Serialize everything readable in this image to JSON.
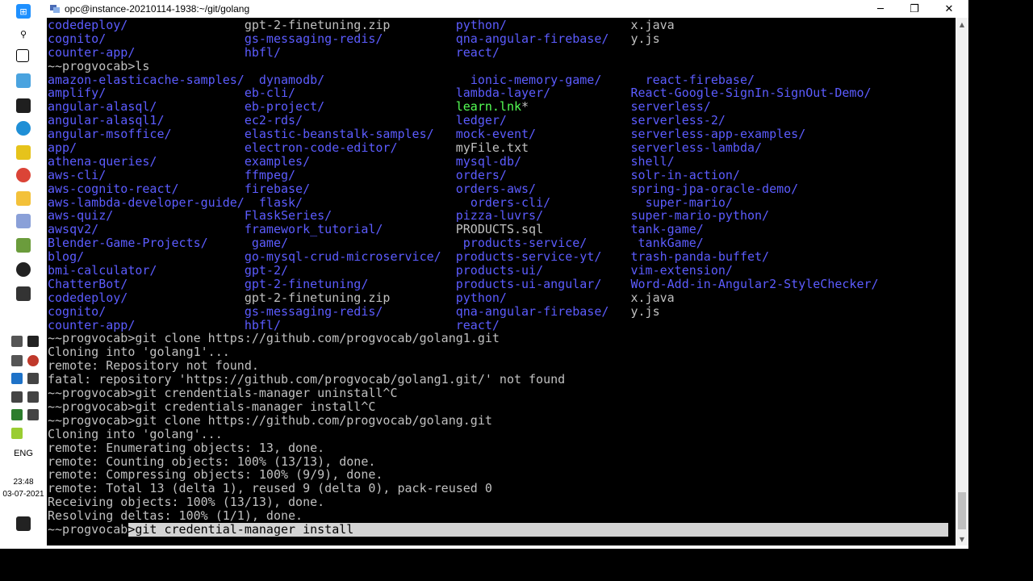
{
  "window": {
    "title": "opc@instance-20210114-1938:~/git/golang",
    "minimize_label": "─",
    "maximize_label": "❐",
    "close_label": "✕"
  },
  "taskbar": {
    "icons": [
      "windows-start-icon",
      "search-icon",
      "task-view-icon",
      "remote-desktop-icon",
      "store-icon",
      "edge-icon",
      "sticky-notes-icon",
      "chrome-icon",
      "file-explorer-icon",
      "putty-icon",
      "notepad-icon",
      "obs-icon",
      "terminal-icon"
    ],
    "language": "ENG",
    "time": "23:48",
    "date": "03-07-2021"
  },
  "terminal": {
    "lines": [
      [
        [
          "codedeploy/",
          "dir"
        ],
        [
          "                ",
          ""
        ],
        [
          "gpt-2-finetuning.zip",
          ""
        ],
        [
          "         ",
          ""
        ],
        [
          "python/",
          "dir"
        ],
        [
          "                 ",
          ""
        ],
        [
          "x.java",
          ""
        ]
      ],
      [
        [
          "cognito/",
          "dir"
        ],
        [
          "                   ",
          ""
        ],
        [
          "gs-messaging-redis/",
          "dir"
        ],
        [
          "          ",
          ""
        ],
        [
          "qna-angular-firebase/",
          "dir"
        ],
        [
          "   ",
          ""
        ],
        [
          "y.js",
          ""
        ]
      ],
      [
        [
          "counter-app/",
          "dir"
        ],
        [
          "               ",
          ""
        ],
        [
          "hbfl/",
          "dir"
        ],
        [
          "                        ",
          ""
        ],
        [
          "react/",
          "dir"
        ]
      ],
      [
        [
          "~~progvocab>ls",
          ""
        ]
      ],
      [
        [
          "amazon-elasticache-samples/",
          "dir"
        ],
        [
          "  ",
          ""
        ],
        [
          "dynamodb/",
          "dir"
        ],
        [
          "                    ",
          ""
        ],
        [
          "ionic-memory-game/",
          "dir"
        ],
        [
          "      ",
          ""
        ],
        [
          "react-firebase/",
          "dir"
        ]
      ],
      [
        [
          "amplify/",
          "dir"
        ],
        [
          "                   ",
          ""
        ],
        [
          "eb-cli/",
          "dir"
        ],
        [
          "                      ",
          ""
        ],
        [
          "lambda-layer/",
          "dir"
        ],
        [
          "           ",
          ""
        ],
        [
          "React-Google-SignIn-SignOut-Demo/",
          "dir"
        ]
      ],
      [
        [
          "angular-alasql/",
          "dir"
        ],
        [
          "            ",
          ""
        ],
        [
          "eb-project/",
          "dir"
        ],
        [
          "                  ",
          ""
        ],
        [
          "learn.lnk",
          "link"
        ],
        [
          "*",
          ""
        ],
        [
          "              ",
          ""
        ],
        [
          "serverless/",
          "dir"
        ]
      ],
      [
        [
          "angular-alasql1/",
          "dir"
        ],
        [
          "           ",
          ""
        ],
        [
          "ec2-rds/",
          "dir"
        ],
        [
          "                     ",
          ""
        ],
        [
          "ledger/",
          "dir"
        ],
        [
          "                 ",
          ""
        ],
        [
          "serverless-2/",
          "dir"
        ]
      ],
      [
        [
          "angular-msoffice/",
          "dir"
        ],
        [
          "          ",
          ""
        ],
        [
          "elastic-beanstalk-samples/",
          "dir"
        ],
        [
          "   ",
          ""
        ],
        [
          "mock-event/",
          "dir"
        ],
        [
          "             ",
          ""
        ],
        [
          "serverless-app-examples/",
          "dir"
        ]
      ],
      [
        [
          "app/",
          "dir"
        ],
        [
          "                       ",
          ""
        ],
        [
          "electron-code-editor/",
          "dir"
        ],
        [
          "        ",
          ""
        ],
        [
          "myFile.txt",
          ""
        ],
        [
          "              ",
          ""
        ],
        [
          "serverless-lambda/",
          "dir"
        ]
      ],
      [
        [
          "athena-queries/",
          "dir"
        ],
        [
          "            ",
          ""
        ],
        [
          "examples/",
          "dir"
        ],
        [
          "                    ",
          ""
        ],
        [
          "mysql-db/",
          "dir"
        ],
        [
          "               ",
          ""
        ],
        [
          "shell/",
          "dir"
        ]
      ],
      [
        [
          "aws-cli/",
          "dir"
        ],
        [
          "                   ",
          ""
        ],
        [
          "ffmpeg/",
          "dir"
        ],
        [
          "                      ",
          ""
        ],
        [
          "orders/",
          "dir"
        ],
        [
          "                 ",
          ""
        ],
        [
          "solr-in-action/",
          "dir"
        ]
      ],
      [
        [
          "aws-cognito-react/",
          "dir"
        ],
        [
          "         ",
          ""
        ],
        [
          "firebase/",
          "dir"
        ],
        [
          "                    ",
          ""
        ],
        [
          "orders-aws/",
          "dir"
        ],
        [
          "             ",
          ""
        ],
        [
          "spring-jpa-oracle-demo/",
          "dir"
        ]
      ],
      [
        [
          "aws-lambda-developer-guide/",
          "dir"
        ],
        [
          "  ",
          ""
        ],
        [
          "flask/",
          "dir"
        ],
        [
          "                       ",
          ""
        ],
        [
          "orders-cli/",
          "dir"
        ],
        [
          "             ",
          ""
        ],
        [
          "super-mario/",
          "dir"
        ]
      ],
      [
        [
          "aws-quiz/",
          "dir"
        ],
        [
          "                  ",
          ""
        ],
        [
          "FlaskSeries/",
          "dir"
        ],
        [
          "                 ",
          ""
        ],
        [
          "pizza-luvrs/",
          "dir"
        ],
        [
          "            ",
          ""
        ],
        [
          "super-mario-python/",
          "dir"
        ]
      ],
      [
        [
          "awsqv2/",
          "dir"
        ],
        [
          "                    ",
          ""
        ],
        [
          "framework_tutorial/",
          "dir"
        ],
        [
          "          ",
          ""
        ],
        [
          "PRODUCTS.sql",
          ""
        ],
        [
          "            ",
          ""
        ],
        [
          "tank-game/",
          "dir"
        ]
      ],
      [
        [
          "Blender-Game-Projects/",
          "dir"
        ],
        [
          "      ",
          ""
        ],
        [
          "game/",
          "dir"
        ],
        [
          "                        ",
          ""
        ],
        [
          "products-service/",
          "dir"
        ],
        [
          "       ",
          ""
        ],
        [
          "tankGame/",
          "dir"
        ]
      ],
      [
        [
          "blog/",
          "dir"
        ],
        [
          "                      ",
          ""
        ],
        [
          "go-mysql-crud-microservice/",
          "dir"
        ],
        [
          "  ",
          ""
        ],
        [
          "products-service-yt/",
          "dir"
        ],
        [
          "    ",
          ""
        ],
        [
          "trash-panda-buffet/",
          "dir"
        ]
      ],
      [
        [
          "bmi-calculator/",
          "dir"
        ],
        [
          "            ",
          ""
        ],
        [
          "gpt-2/",
          "dir"
        ],
        [
          "                       ",
          ""
        ],
        [
          "products-ui/",
          "dir"
        ],
        [
          "            ",
          ""
        ],
        [
          "vim-extension/",
          "dir"
        ]
      ],
      [
        [
          "ChatterBot/",
          "dir"
        ],
        [
          "                ",
          ""
        ],
        [
          "gpt-2-finetuning/",
          "dir"
        ],
        [
          "            ",
          ""
        ],
        [
          "products-ui-angular/",
          "dir"
        ],
        [
          "    ",
          ""
        ],
        [
          "Word-Add-in-Angular2-StyleChecker/",
          "dir"
        ]
      ],
      [
        [
          "codedeploy/",
          "dir"
        ],
        [
          "                ",
          ""
        ],
        [
          "gpt-2-finetuning.zip",
          ""
        ],
        [
          "         ",
          ""
        ],
        [
          "python/",
          "dir"
        ],
        [
          "                 ",
          ""
        ],
        [
          "x.java",
          ""
        ]
      ],
      [
        [
          "cognito/",
          "dir"
        ],
        [
          "                   ",
          ""
        ],
        [
          "gs-messaging-redis/",
          "dir"
        ],
        [
          "          ",
          ""
        ],
        [
          "qna-angular-firebase/",
          "dir"
        ],
        [
          "   ",
          ""
        ],
        [
          "y.js",
          ""
        ]
      ],
      [
        [
          "counter-app/",
          "dir"
        ],
        [
          "               ",
          ""
        ],
        [
          "hbfl/",
          "dir"
        ],
        [
          "                        ",
          ""
        ],
        [
          "react/",
          "dir"
        ]
      ],
      [
        [
          "~~progvocab>git clone https://github.com/progvocab/golang1.git",
          ""
        ]
      ],
      [
        [
          "Cloning into 'golang1'...",
          ""
        ]
      ],
      [
        [
          "remote: Repository not found.",
          ""
        ]
      ],
      [
        [
          "fatal: repository 'https://github.com/progvocab/golang1.git/' not found",
          ""
        ]
      ],
      [
        [
          "~~progvocab>git crendentials-manager uninstall^C",
          ""
        ]
      ],
      [
        [
          "~~progvocab>git credentials-manager install^C",
          ""
        ]
      ],
      [
        [
          "~~progvocab>git clone https://github.com/progvocab/golang.git",
          ""
        ]
      ],
      [
        [
          "Cloning into 'golang'...",
          ""
        ]
      ],
      [
        [
          "remote: Enumerating objects: 13, done.",
          ""
        ]
      ],
      [
        [
          "remote: Counting objects: 100% (13/13), done.",
          ""
        ]
      ],
      [
        [
          "remote: Compressing objects: 100% (9/9), done.",
          ""
        ]
      ],
      [
        [
          "remote: Total 13 (delta 1), reused 9 (delta 0), pack-reused 0",
          ""
        ]
      ],
      [
        [
          "Receiving objects: 100% (13/13), done.",
          ""
        ]
      ],
      [
        [
          "Resolving deltas: 100% (1/1), done.",
          ""
        ]
      ]
    ],
    "prompt": "~~progvocab",
    "current_input": ">git credential-manager install"
  }
}
